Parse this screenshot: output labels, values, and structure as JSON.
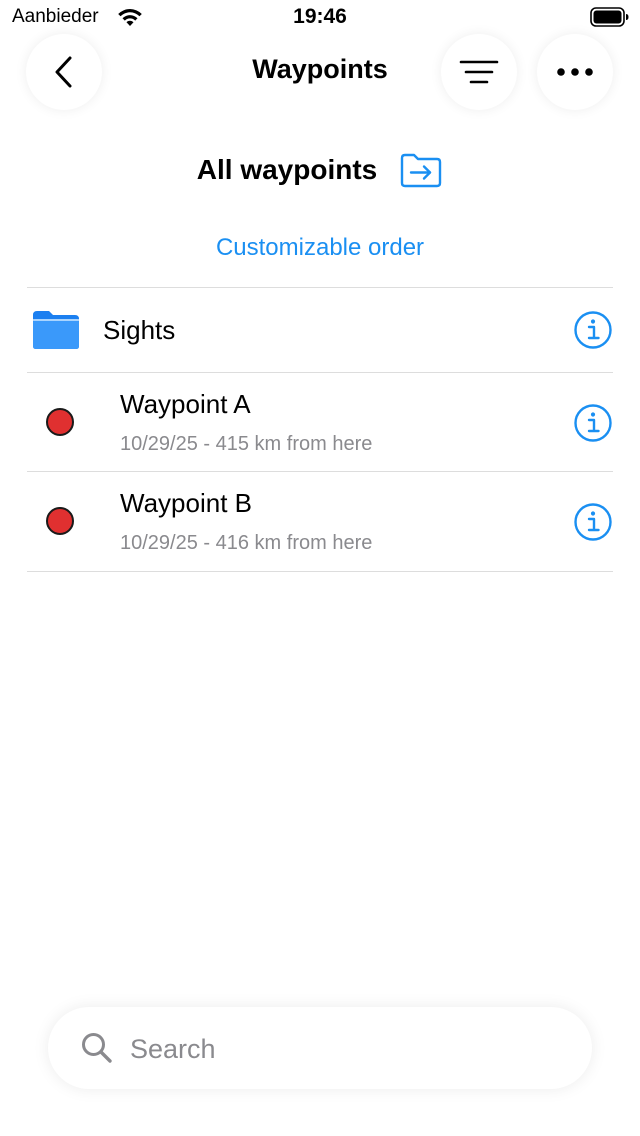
{
  "status_bar": {
    "carrier": "Aanbieder",
    "time": "19:46"
  },
  "nav": {
    "title": "Waypoints",
    "back_icon": "chevron-left-icon",
    "filter_icon": "sort-lines-icon",
    "more_icon": "ellipsis-icon"
  },
  "folder_header": {
    "title": "All waypoints",
    "icon": "move-to-folder-icon"
  },
  "sort_order_label": "Customizable order",
  "list": {
    "folder": {
      "name": "Sights",
      "icon": "folder-icon"
    },
    "waypoints": [
      {
        "name": "Waypoint A",
        "subtitle": "10/29/25 - 415 km from here",
        "color": "#e03030"
      },
      {
        "name": "Waypoint B",
        "subtitle": "10/29/25 - 416 km from here",
        "color": "#e03030"
      }
    ]
  },
  "search": {
    "placeholder": "Search",
    "value": ""
  },
  "colors": {
    "accent": "#1a8ff2",
    "secondary_text": "#8a8a8e",
    "waypoint_red": "#e03030"
  }
}
